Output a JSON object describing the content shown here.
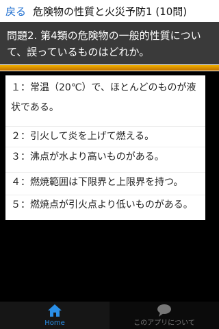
{
  "header": {
    "back_label": "戻る",
    "title": "危険物の性質と火災予防1 (10問)"
  },
  "question": {
    "text": "問題2. 第4類の危険物の一般的性質について、誤っているものはどれか。"
  },
  "answers": [
    {
      "text": "１：常温（20℃）で、ほとんどのものが液状である。"
    },
    {
      "text": "２：引火して炎を上げて燃える。"
    },
    {
      "text": "３：沸点が水より高いものがある。"
    },
    {
      "text": "４：燃焼範囲は下限界と上限界を持つ。"
    },
    {
      "text": "５：燃焼点が引火点より低いものがある。"
    }
  ],
  "nav": {
    "home_label": "Home",
    "about_label": "このアプリについて"
  },
  "colors": {
    "accent": "#2a8fe8",
    "divider": "#e89a00",
    "question_bg": "#3a3a3a"
  }
}
